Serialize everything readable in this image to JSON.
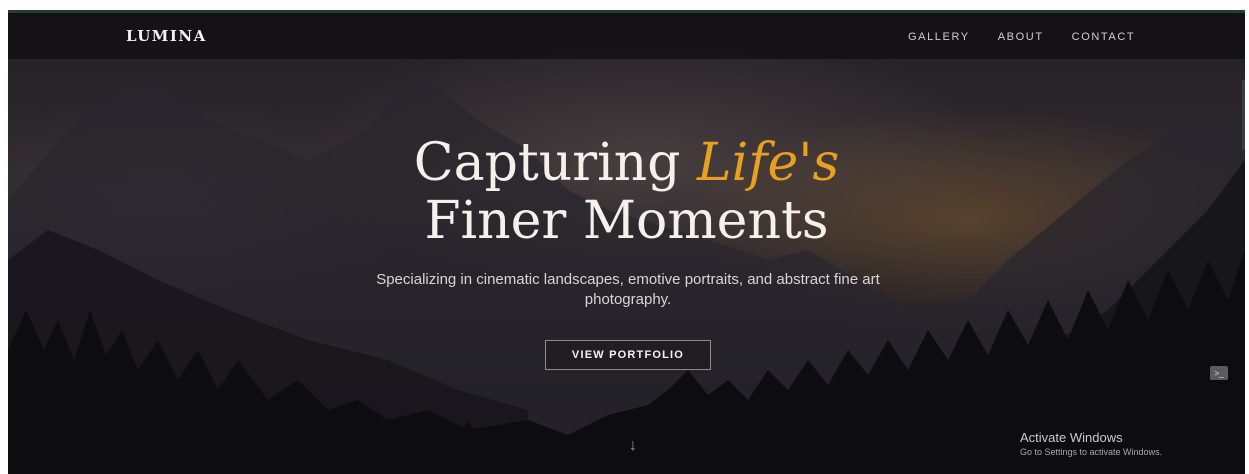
{
  "brand": {
    "logo": "LUMINA"
  },
  "nav": {
    "items": [
      {
        "label": "GALLERY"
      },
      {
        "label": "ABOUT"
      },
      {
        "label": "CONTACT"
      }
    ]
  },
  "hero": {
    "title_part1": "Capturing ",
    "title_accent": "Life's",
    "title_line2": "Finer Moments",
    "subtitle": "Specializing in cinematic landscapes, emotive portraits, and abstract fine art photography.",
    "cta_label": "VIEW PORTFOLIO",
    "scroll_icon": "arrow-down-icon",
    "accent_color": "#e8a020"
  },
  "os_overlay": {
    "title": "Activate Windows",
    "subtitle": "Go to Settings to activate Windows."
  }
}
